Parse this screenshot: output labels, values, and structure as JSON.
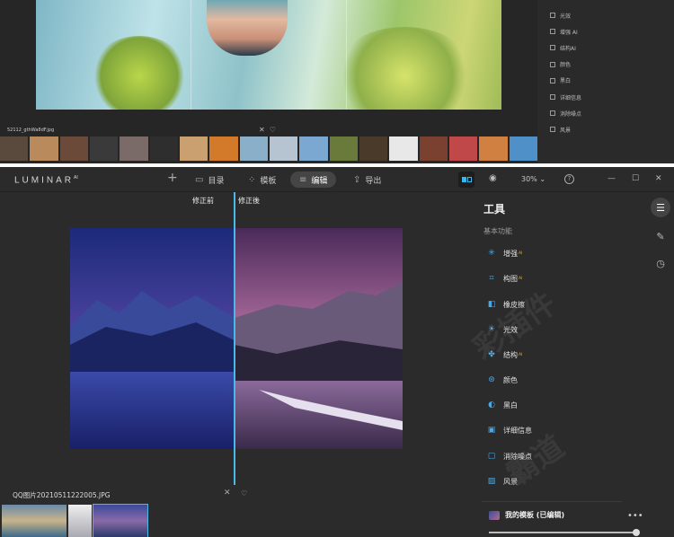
{
  "top_preview": {
    "filename": "52112_gthWa8dF.jpg",
    "side_items": [
      "光效",
      "增强 AI",
      "结构AI",
      "颜色",
      "黑白",
      "详细信息",
      "消除噪点",
      "风景"
    ]
  },
  "app": {
    "logo": "LUMINAR",
    "logo_sup": "AI",
    "toolbar": {
      "catalog": "目录",
      "templates": "模板",
      "edit": "编辑",
      "export": "导出",
      "zoom": "30%"
    }
  },
  "canvas": {
    "before_label": "修正前",
    "after_label": "修正後"
  },
  "filmstrip": {
    "filename": "QQ图片20210511222005.JPG"
  },
  "panel": {
    "title": "工具",
    "section": "基本功能",
    "tools": [
      {
        "label": "增强",
        "ai": "AI",
        "icon": "sparkle-icon"
      },
      {
        "label": "构图",
        "ai": "AI",
        "icon": "crop-icon"
      },
      {
        "label": "橡皮擦",
        "ai": "",
        "icon": "eraser-icon"
      },
      {
        "label": "光效",
        "ai": "",
        "icon": "sun-icon"
      },
      {
        "label": "结构",
        "ai": "AI",
        "icon": "structure-icon"
      },
      {
        "label": "颜色",
        "ai": "",
        "icon": "color-icon"
      },
      {
        "label": "黑白",
        "ai": "",
        "icon": "bw-icon"
      },
      {
        "label": "详细信息",
        "ai": "",
        "icon": "details-icon"
      },
      {
        "label": "消除噪点",
        "ai": "",
        "icon": "denoise-icon"
      },
      {
        "label": "风景",
        "ai": "",
        "icon": "landscape-icon"
      }
    ],
    "my_template": "我的模板 (已编辑)",
    "template_amount": 1.0
  },
  "colors": {
    "accent": "#48b9e8",
    "background": "#2b2b2b"
  }
}
